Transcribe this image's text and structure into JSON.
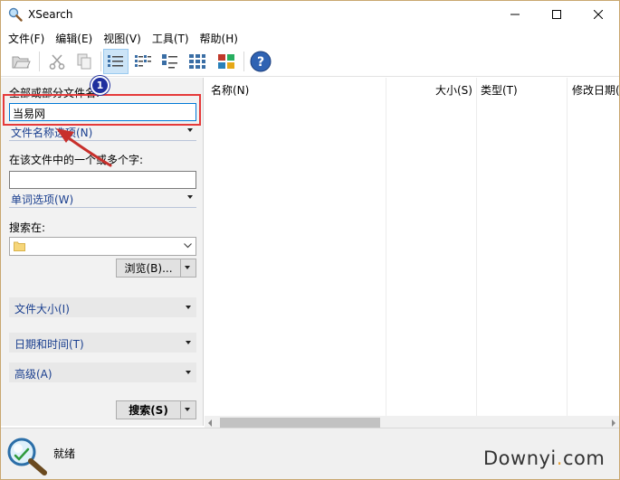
{
  "window": {
    "title": "XSearch",
    "icons": {
      "app": "magnifier-icon",
      "minimize": "minimize-icon",
      "maximize": "maximize-icon",
      "close": "close-icon"
    }
  },
  "menu": {
    "items": [
      "文件(F)",
      "编辑(E)",
      "视图(V)",
      "工具(T)",
      "帮助(H)"
    ]
  },
  "toolbar": {
    "buttons": [
      {
        "icon": "open-folder-icon",
        "active": false
      },
      {
        "icon": "cut-icon",
        "active": false
      },
      {
        "icon": "copy-icon",
        "active": false
      },
      {
        "icon": "details-view-icon",
        "active": true
      },
      {
        "icon": "list-view-icon",
        "active": false
      },
      {
        "icon": "small-icons-view-icon",
        "active": false
      },
      {
        "icon": "large-icons-view-icon",
        "active": false
      },
      {
        "icon": "thumbnails-view-icon",
        "active": false
      },
      {
        "icon": "help-icon",
        "active": false
      }
    ]
  },
  "search_panel": {
    "filename_label": "全部或部分文件名:",
    "filename_value": "当易网",
    "filename_options": "文件名称选项(N)",
    "content_label": "在该文件中的一个或多个字:",
    "content_value": "",
    "word_options": "单词选项(W)",
    "search_in_label": "搜索在:",
    "search_in_value": "",
    "browse_button": "浏览(B)...",
    "file_size": "文件大小(I)",
    "date_time": "日期和时间(T)",
    "advanced": "高级(A)",
    "search_button": "搜索(S)"
  },
  "results": {
    "columns": [
      "名称(N)",
      "大小(S)",
      "类型(T)",
      "修改日期("
    ]
  },
  "status": {
    "text": "就绪",
    "icon": "search-magnifier-icon"
  },
  "watermark": {
    "prefix": "Downyi",
    "dot": ".",
    "suffix": "com"
  },
  "annotation": {
    "badge": "1",
    "color": "#e53a3a"
  }
}
